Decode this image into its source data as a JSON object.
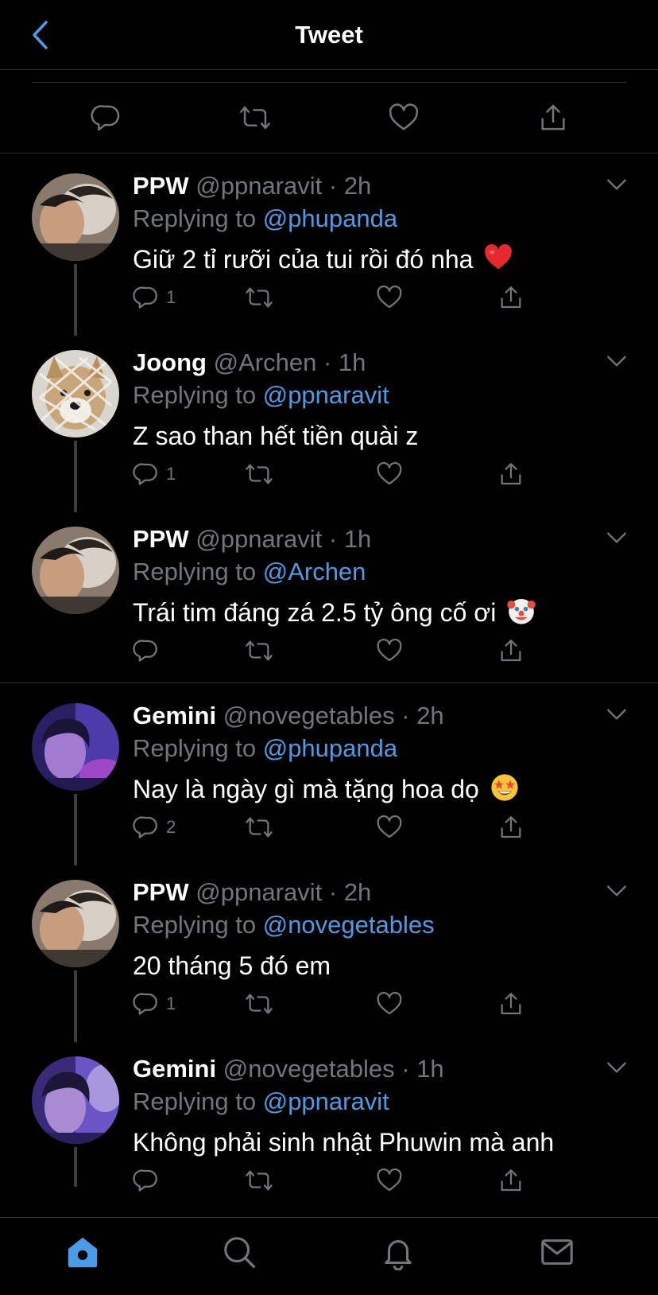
{
  "header": {
    "title": "Tweet",
    "back_icon": "chevron-left-icon"
  },
  "colors": {
    "background": "#000000",
    "accent": "#4a9ce8",
    "muted": "#71767b",
    "divider": "#2f3336"
  },
  "main_actions": [
    "reply-icon",
    "retweet-icon",
    "like-icon",
    "share-icon"
  ],
  "replies": [
    {
      "name": "PPW",
      "handle": "@ppnaravit",
      "time": "2h",
      "replying_label": "Replying to",
      "replying_to": "@phupanda",
      "text": "Giữ 2 tỉ rưỡi của tui rồi đó nha",
      "emoji": "red-heart",
      "reply_count": "1"
    },
    {
      "name": "Joong",
      "handle": "@Archen",
      "time": "1h",
      "replying_label": "Replying to",
      "replying_to": "@ppnaravit",
      "text": "Z sao than hết tiền quài z",
      "emoji": "",
      "reply_count": "1"
    },
    {
      "name": "PPW",
      "handle": "@ppnaravit",
      "time": "1h",
      "replying_label": "Replying to",
      "replying_to": "@Archen",
      "text": "Trái tim đáng zá 2.5 tỷ ông cố ơi",
      "emoji": "clown-face",
      "reply_count": ""
    },
    {
      "name": "Gemini",
      "handle": "@novegetables",
      "time": "2h",
      "replying_label": "Replying to",
      "replying_to": "@phupanda",
      "text": "Nay là ngày gì mà tặng hoa dọ",
      "emoji": "star-struck",
      "reply_count": "2"
    },
    {
      "name": "PPW",
      "handle": "@ppnaravit",
      "time": "2h",
      "replying_label": "Replying to",
      "replying_to": "@novegetables",
      "text": "20 tháng 5 đó em",
      "emoji": "",
      "reply_count": "1"
    },
    {
      "name": "Gemini",
      "handle": "@novegetables",
      "time": "1h",
      "replying_label": "Replying to",
      "replying_to": "@ppnaravit",
      "text": "Không phải sinh nhật Phuwin mà anh",
      "emoji": "",
      "reply_count": ""
    }
  ],
  "tabbar": {
    "items": [
      "home-icon",
      "search-icon",
      "notifications-icon",
      "messages-icon"
    ],
    "active": "home-icon"
  }
}
